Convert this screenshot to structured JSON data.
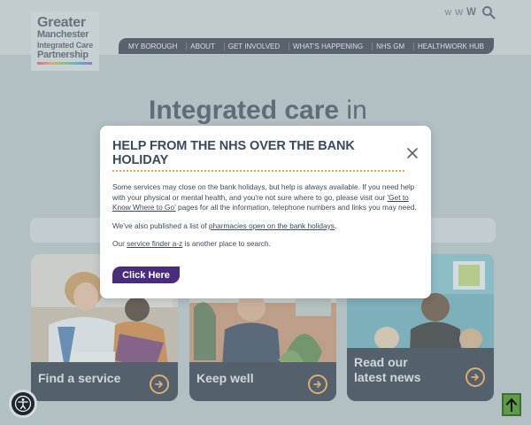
{
  "logo": {
    "line1": "Greater",
    "line2": "Manchester",
    "line3": "Integrated Care",
    "line4": "Partnership"
  },
  "text_size": {
    "small": "W",
    "medium": "W",
    "large": "W"
  },
  "nav": {
    "items": [
      {
        "label": "MY BOROUGH"
      },
      {
        "label": "ABOUT"
      },
      {
        "label": "GET INVOLVED"
      },
      {
        "label": "WHAT'S HAPPENING"
      },
      {
        "label": "NHS GM"
      },
      {
        "label": "HEALTHWORK HUB"
      }
    ]
  },
  "hero": {
    "title_bold": "Integrated care",
    "title_light": " in"
  },
  "cards": [
    {
      "label": "Find a service"
    },
    {
      "label": "Keep well"
    },
    {
      "label_line1": "Read our",
      "label_line2": "latest news"
    }
  ],
  "modal": {
    "title": "HELP FROM THE NHS OVER THE BANK HOLIDAY",
    "p1_text": "Some services may close on the bank holidays, but help is always available. If you need help with your physical or mental health, and you're not sure where to go, please visit our ",
    "p1_link": "'Get to Know Where to Go'",
    "p1_after": " pages for all the information, telephone numbers and links you may need.",
    "p2_text": "We've also published a list of ",
    "p2_link": "pharmacies open on the bank holidays",
    "p2_after": ".",
    "p3_text": "Our ",
    "p3_link": "service finder a-z",
    "p3_after": " is another place to search.",
    "button_label": "Click Here"
  },
  "colors": {
    "nav_bg": "#222b3a",
    "accent_orange": "#f2a43c",
    "button_purple": "#4a2c7e",
    "heading_text": "#3b4a5c",
    "back_to_top_green": "#5e9a4a"
  },
  "icons": {
    "search": "search-icon",
    "close": "close-icon",
    "card_arrow": "arrow-right-icon",
    "accessibility": "accessibility-icon",
    "back_to_top": "arrow-up-icon"
  }
}
